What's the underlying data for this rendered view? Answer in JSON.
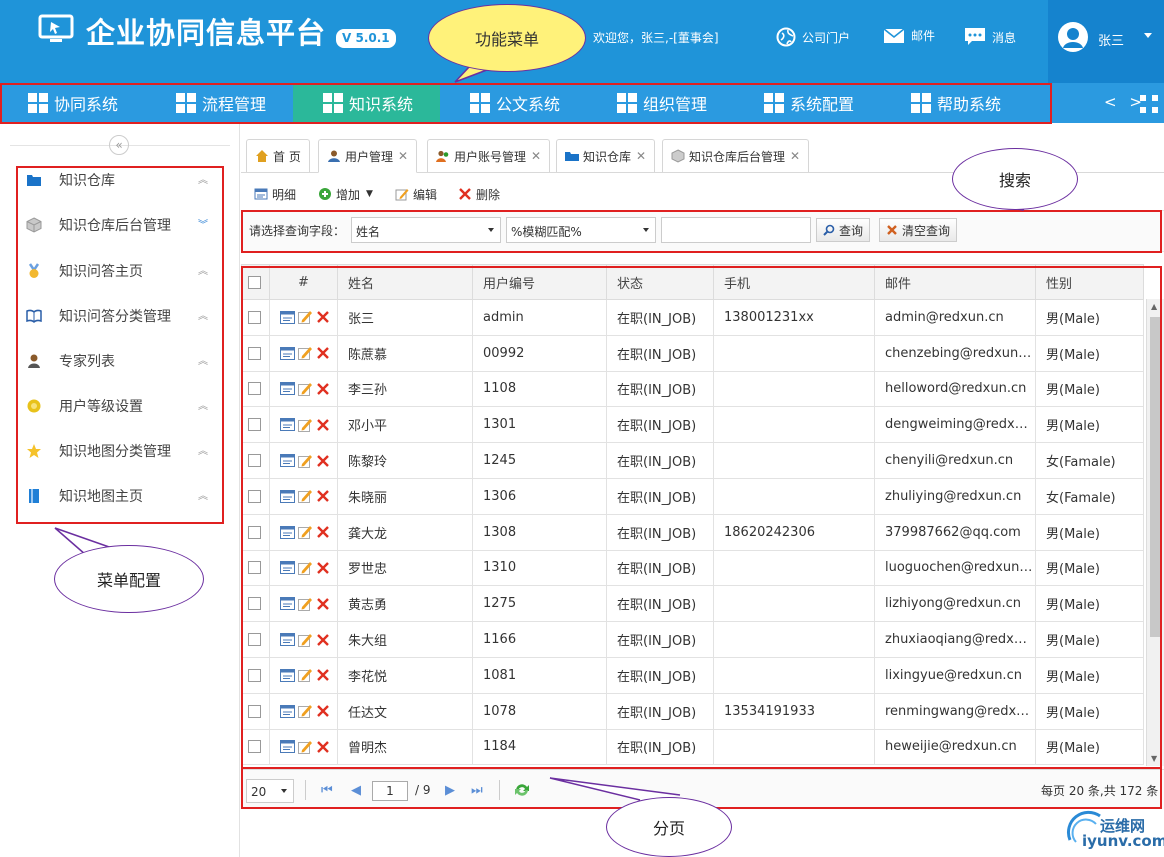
{
  "header": {
    "title": "企业协同信息平台",
    "version": "V 5.0.1",
    "welcome": "欢迎您，张三,-[董事会]",
    "links": [
      {
        "label": "公司门户",
        "icon": "globe-icon"
      },
      {
        "label": "邮件",
        "icon": "mail-icon"
      },
      {
        "label": "消息",
        "icon": "chat-icon"
      }
    ],
    "user_name": "张三"
  },
  "nav": {
    "items": [
      {
        "label": "协同系统"
      },
      {
        "label": "流程管理"
      },
      {
        "label": "知识系统"
      },
      {
        "label": "公文系统"
      },
      {
        "label": "组织管理"
      },
      {
        "label": "系统配置"
      },
      {
        "label": "帮助系统"
      }
    ],
    "active_index": 2,
    "arrows": "< >"
  },
  "sidebar": {
    "collapse": "«",
    "items": [
      {
        "label": "知识仓库",
        "icon": "folder-icon",
        "chevron": "︽"
      },
      {
        "label": "知识仓库后台管理",
        "icon": "cube-icon",
        "chevron": "︾"
      },
      {
        "label": "知识问答主页",
        "icon": "medal-icon",
        "chevron": "︽"
      },
      {
        "label": "知识问答分类管理",
        "icon": "book-icon",
        "chevron": "︽"
      },
      {
        "label": "专家列表",
        "icon": "expert-icon",
        "chevron": "︽"
      },
      {
        "label": "用户等级设置",
        "icon": "gear-sun-icon",
        "chevron": "︽"
      },
      {
        "label": "知识地图分类管理",
        "icon": "star-icon",
        "chevron": "︽"
      },
      {
        "label": "知识地图主页",
        "icon": "bookmark-icon",
        "chevron": "︽"
      }
    ]
  },
  "tabs": [
    {
      "label": "首 页",
      "icon": "home-icon",
      "closable": false
    },
    {
      "label": "用户管理",
      "icon": "user-icon",
      "closable": true
    },
    {
      "label": "用户账号管理",
      "icon": "users-icon",
      "closable": true
    },
    {
      "label": "知识仓库",
      "icon": "folder-icon",
      "closable": true
    },
    {
      "label": "知识仓库后台管理",
      "icon": "cube-icon",
      "closable": true
    }
  ],
  "toolbar": {
    "detail": "明细",
    "add": "增加",
    "edit": "编辑",
    "delete": "删除"
  },
  "search": {
    "label": "请选择查询字段：",
    "field_value": "姓名",
    "match_value": "%模糊匹配%",
    "text_value": "",
    "query_button": "查询",
    "clear_button": "清空查询"
  },
  "table": {
    "columns": [
      "#",
      "姓名",
      "用户编号",
      "状态",
      "手机",
      "邮件",
      "性别"
    ],
    "rows": [
      {
        "name": "张三",
        "code": "admin",
        "status": "在职(IN_JOB)",
        "phone": "138001231xx",
        "email": "admin@redxun.cn",
        "gender": "男(Male)",
        "female": false
      },
      {
        "name": "陈蔗慕",
        "code": "00992",
        "status": "在职(IN_JOB)",
        "phone": "",
        "email": "chenzebing@redxun.cn",
        "gender": "男(Male)",
        "female": false
      },
      {
        "name": "李三孙",
        "code": "1108",
        "status": "在职(IN_JOB)",
        "phone": "",
        "email": "helloword@redxun.cn",
        "gender": "男(Male)",
        "female": false
      },
      {
        "name": "邓小平",
        "code": "1301",
        "status": "在职(IN_JOB)",
        "phone": "",
        "email": "dengweiming@redxun...",
        "gender": "男(Male)",
        "female": false
      },
      {
        "name": "陈黎玲",
        "code": "1245",
        "status": "在职(IN_JOB)",
        "phone": "",
        "email": "chenyili@redxun.cn",
        "gender": "女(Famale)",
        "female": true
      },
      {
        "name": "朱晓丽",
        "code": "1306",
        "status": "在职(IN_JOB)",
        "phone": "",
        "email": "zhuliying@redxun.cn",
        "gender": "女(Famale)",
        "female": true
      },
      {
        "name": "龚大龙",
        "code": "1308",
        "status": "在职(IN_JOB)",
        "phone": "18620242306",
        "email": "379987662@qq.com",
        "gender": "男(Male)",
        "female": false
      },
      {
        "name": "罗世忠",
        "code": "1310",
        "status": "在职(IN_JOB)",
        "phone": "",
        "email": "luoguochen@redxun.cn",
        "gender": "男(Male)",
        "female": false
      },
      {
        "name": "黄志勇",
        "code": "1275",
        "status": "在职(IN_JOB)",
        "phone": "",
        "email": "lizhiyong@redxun.cn",
        "gender": "男(Male)",
        "female": false
      },
      {
        "name": "朱大组",
        "code": "1166",
        "status": "在职(IN_JOB)",
        "phone": "",
        "email": "zhuxiaoqiang@redxun...",
        "gender": "男(Male)",
        "female": false
      },
      {
        "name": "李花悦",
        "code": "1081",
        "status": "在职(IN_JOB)",
        "phone": "",
        "email": "lixingyue@redxun.cn",
        "gender": "男(Male)",
        "female": false
      },
      {
        "name": "任达文",
        "code": "1078",
        "status": "在职(IN_JOB)",
        "phone": "13534191933",
        "email": "renmingwang@redxu...",
        "gender": "男(Male)",
        "female": false
      },
      {
        "name": "曾明杰",
        "code": "1184",
        "status": "在职(IN_JOB)",
        "phone": "",
        "email": "heweijie@redxun.cn",
        "gender": "男(Male)",
        "female": false
      }
    ]
  },
  "pager": {
    "page_size": "20",
    "current_page": "1",
    "total_pages": "/ 9",
    "info": "每页 20 条,共 172 条"
  },
  "annotations": {
    "menu_callout": "功能菜单",
    "search_callout": "搜索",
    "sidebar_callout": "菜单配置",
    "pager_callout": "分页"
  },
  "watermark": {
    "line1": "运维网",
    "line2": "iyunv.com"
  },
  "colors": {
    "header_blue": "#1f94d9",
    "nav_blue": "#2b9ae0",
    "nav_active": "#2bb89a",
    "status_green": "#2a9a2a",
    "female_blue": "#2a5ad6",
    "annotation_red": "#e02020",
    "callout_purple": "#6b2fa0",
    "menu_callout_fill": "#fff27a"
  }
}
